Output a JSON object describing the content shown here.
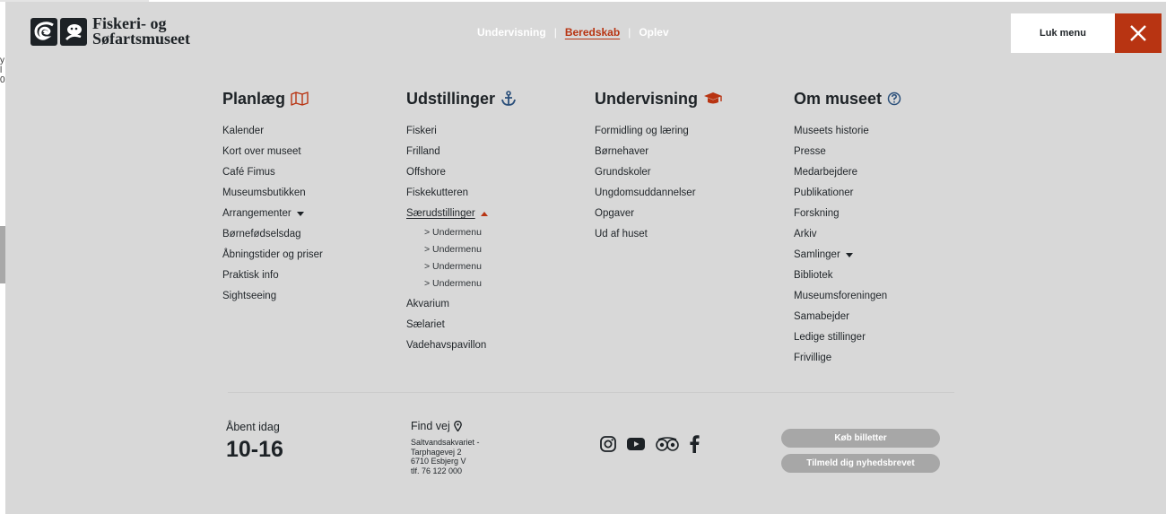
{
  "background_text": [
    "y",
    "l",
    "0",
    "",
    "",
    "",
    "",
    "",
    "",
    "",
    "",
    "ı"
  ],
  "brand": {
    "line1": "Fiskeri- og",
    "line2": "Søfartsmuseet"
  },
  "topnav": [
    {
      "label": "Undervisning",
      "active": false
    },
    {
      "label": "Beredskab",
      "active": true
    },
    {
      "label": "Oplev",
      "active": false
    }
  ],
  "topnav_separator": "|",
  "close": {
    "label": "Luk menu",
    "icon": "close-icon"
  },
  "colors": {
    "accent": "#b83412",
    "text": "#1d2226",
    "overlay": "#d8d8d8",
    "button": "#a7a7a7",
    "icon_blue": "#2a4f7a"
  },
  "columns": [
    {
      "heading": "Planlæg",
      "icon": "map-icon",
      "items": [
        {
          "label": "Kalender"
        },
        {
          "label": "Kort over museet"
        },
        {
          "label": "Café Fimus"
        },
        {
          "label": "Museumsbutikken"
        },
        {
          "label": "Arrangementer",
          "caret": "down"
        },
        {
          "label": "Børnefødselsdag"
        },
        {
          "label": "Åbningstider og priser"
        },
        {
          "label": "Praktisk info"
        },
        {
          "label": "Sightseeing"
        }
      ]
    },
    {
      "heading": "Udstillinger",
      "icon": "anchor-icon",
      "items": [
        {
          "label": "Fiskeri"
        },
        {
          "label": "Frilland"
        },
        {
          "label": "Offshore"
        },
        {
          "label": "Fiskekutteren"
        },
        {
          "label": "Særudstillinger",
          "caret": "up",
          "submenu": [
            "> Undermenu",
            "> Undermenu",
            "> Undermenu",
            "> Undermenu"
          ]
        },
        {
          "label": "Akvarium"
        },
        {
          "label": "Sælariet"
        },
        {
          "label": "Vadehavspavillon"
        }
      ]
    },
    {
      "heading": "Undervisning",
      "icon": "graduation-cap-icon",
      "items": [
        {
          "label": "Formidling og læring"
        },
        {
          "label": "Børnehaver"
        },
        {
          "label": "Grundskoler"
        },
        {
          "label": "Ungdomsuddannelser"
        },
        {
          "label": "Opgaver"
        },
        {
          "label": "Ud af huset"
        }
      ]
    },
    {
      "heading": "Om museet",
      "icon": "question-circle-icon",
      "items": [
        {
          "label": "Museets historie"
        },
        {
          "label": "Presse"
        },
        {
          "label": "Medarbejdere"
        },
        {
          "label": "Publikationer"
        },
        {
          "label": "Forskning"
        },
        {
          "label": "Arkiv"
        },
        {
          "label": "Samlinger",
          "caret": "down"
        },
        {
          "label": "Bibliotek"
        },
        {
          "label": "Museumsforeningen"
        },
        {
          "label": "Samabejder"
        },
        {
          "label": "Ledige stillinger"
        },
        {
          "label": "Frivillige"
        }
      ]
    }
  ],
  "footer": {
    "open_label": "Åbent idag",
    "hours": "10-16",
    "find_label": "Find vej",
    "address": [
      "Saltvandsakvariet -",
      "Tarphagevej 2",
      "6710 Esbjerg V",
      "tlf. 76 122 000"
    ],
    "social": [
      "instagram-icon",
      "youtube-icon",
      "tripadvisor-icon",
      "facebook-icon"
    ],
    "buttons": [
      "Køb billetter",
      "Tilmeld dig nyhedsbrevet"
    ]
  }
}
